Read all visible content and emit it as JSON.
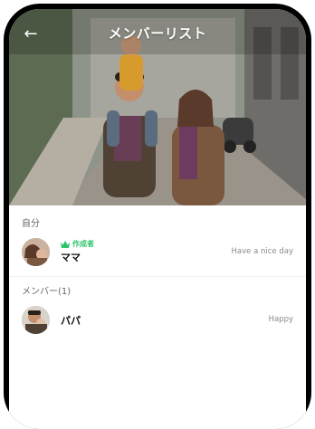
{
  "header": {
    "title": "メンバーリスト",
    "back_icon": "arrow-left-icon"
  },
  "sections": {
    "self": {
      "label": "自分",
      "member": {
        "badge": "作成者",
        "name": "ママ",
        "status": "Have a nice day"
      }
    },
    "members": {
      "label": "メンバー(1)",
      "member": {
        "name": "パパ",
        "status": "Happy"
      }
    }
  },
  "colors": {
    "accent_green": "#2fc46a",
    "title_text": "#ffffff"
  }
}
